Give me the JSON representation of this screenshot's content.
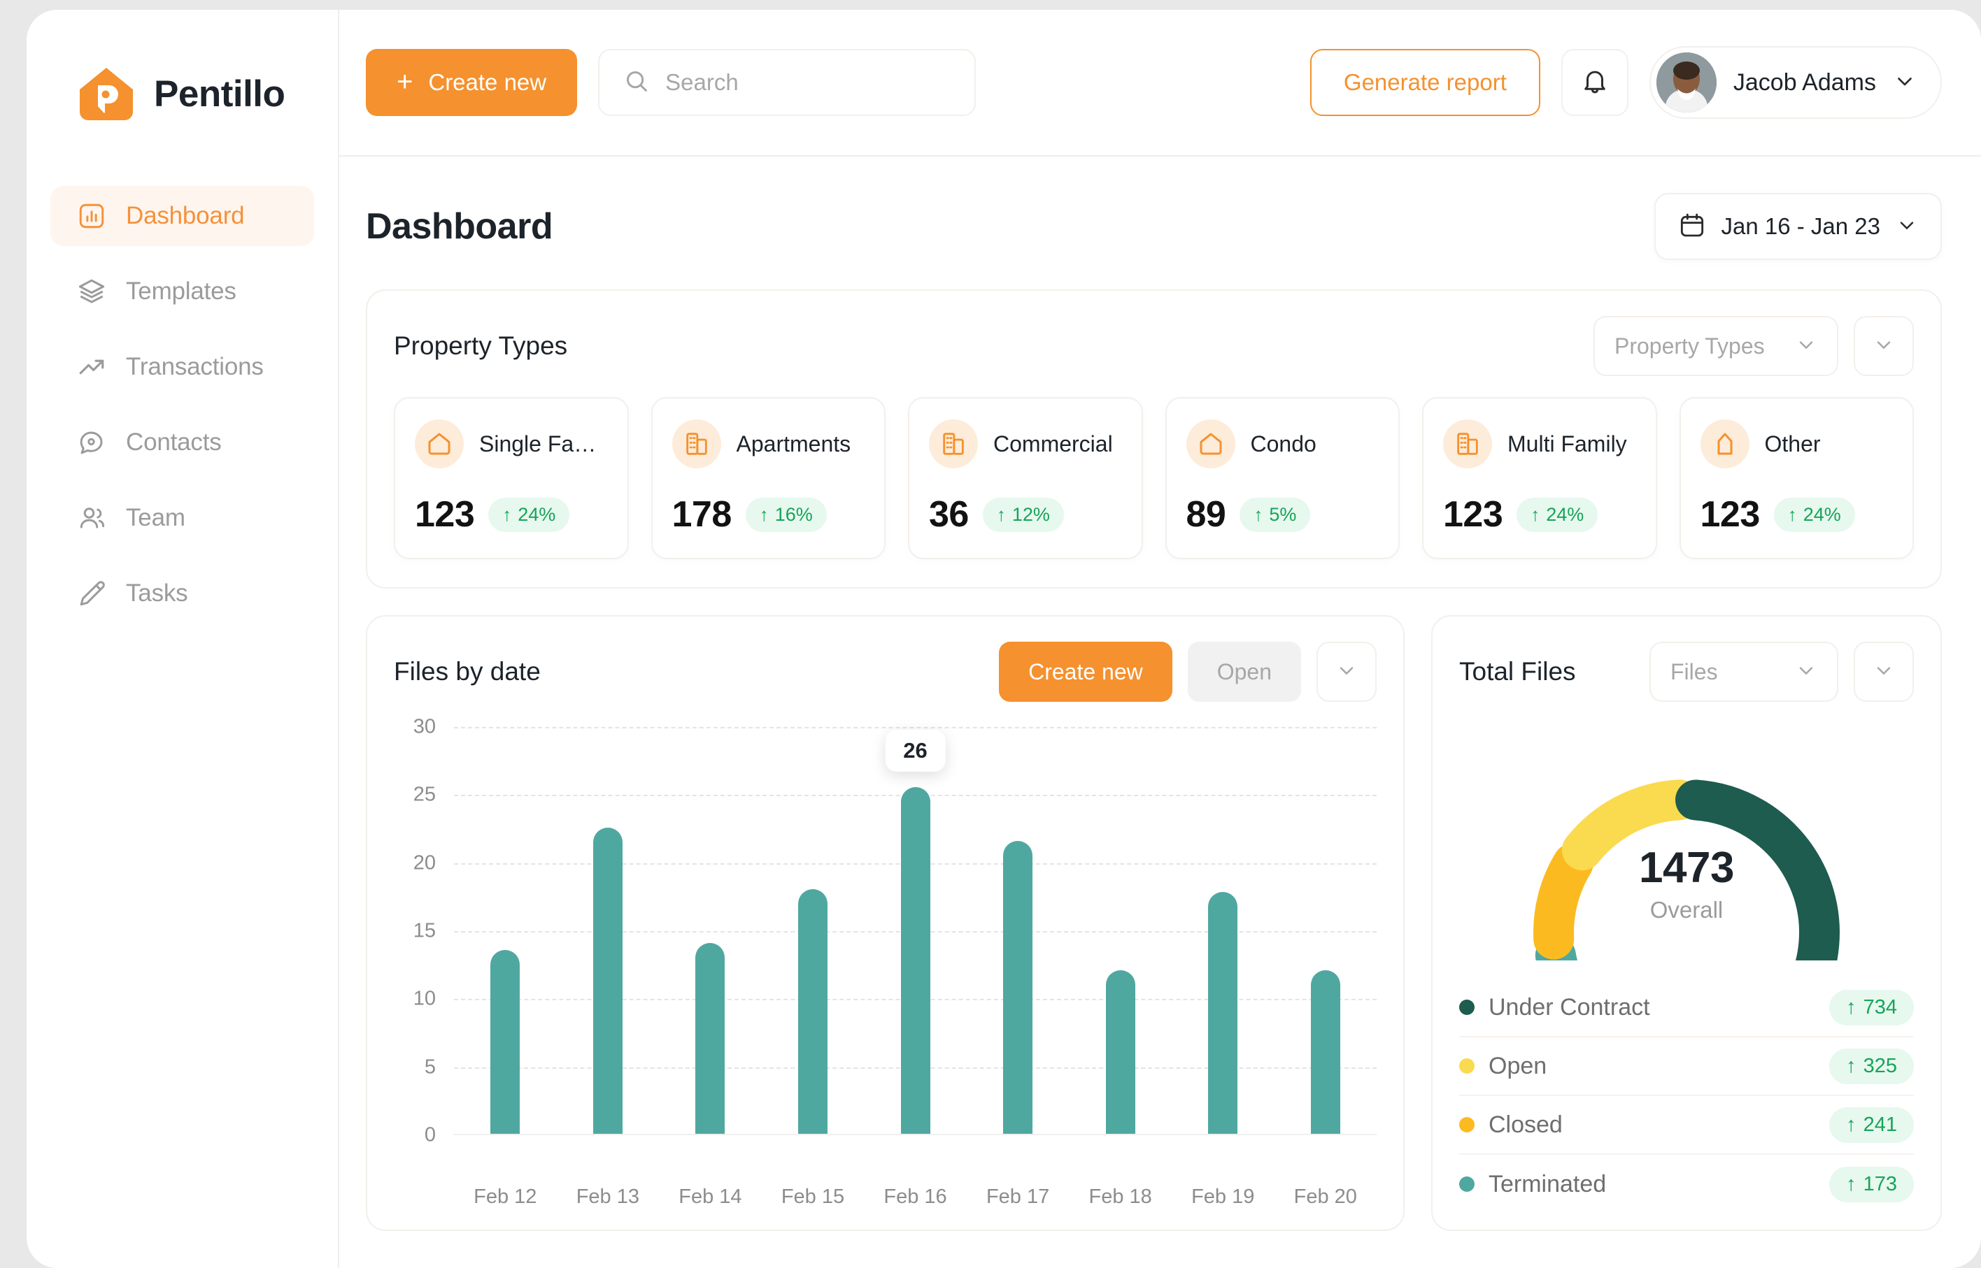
{
  "brand": {
    "name": "Pentillo",
    "logo_icon": "house-p-logo-icon",
    "accent": "#f5912e"
  },
  "sidebar": {
    "items": [
      {
        "label": "Dashboard",
        "icon": "chart-bar-square-icon",
        "active": true
      },
      {
        "label": "Templates",
        "icon": "layers-icon",
        "active": false
      },
      {
        "label": "Transactions",
        "icon": "trending-up-icon",
        "active": false
      },
      {
        "label": "Contacts",
        "icon": "chat-bubble-icon",
        "active": false
      },
      {
        "label": "Team",
        "icon": "users-icon",
        "active": false
      },
      {
        "label": "Tasks",
        "icon": "pencil-icon",
        "active": false
      }
    ]
  },
  "topbar": {
    "create_new_label": "Create new",
    "plus_icon": "plus-icon",
    "search": {
      "placeholder": "Search",
      "value": "",
      "icon": "search-icon"
    },
    "generate_report_label": "Generate report",
    "bell_icon": "bell-icon",
    "user": {
      "name": "Jacob Adams",
      "avatar_icon": "user-avatar",
      "chevron_icon": "chevron-down-icon"
    }
  },
  "page": {
    "title": "Dashboard",
    "date_range": {
      "label": "Jan 16 - Jan 23",
      "calendar_icon": "calendar-icon",
      "chevron_icon": "chevron-down-icon"
    }
  },
  "property_types": {
    "title": "Property Types",
    "filter": {
      "label": "Property Types",
      "chevron_icon": "chevron-down-icon"
    },
    "more_icon": "chevron-down-icon",
    "cards": [
      {
        "label": "Single Family",
        "value": "123",
        "change": "24%",
        "icon": "home-icon",
        "trend_icon": "arrow-up-icon"
      },
      {
        "label": "Apartments",
        "value": "178",
        "change": "16%",
        "icon": "buildings-icon",
        "trend_icon": "arrow-up-icon"
      },
      {
        "label": "Commercial",
        "value": "36",
        "change": "12%",
        "icon": "office-icon",
        "trend_icon": "arrow-up-icon"
      },
      {
        "label": "Condo",
        "value": "89",
        "change": "5%",
        "icon": "home-icon",
        "trend_icon": "arrow-up-icon"
      },
      {
        "label": "Multi Family",
        "value": "123",
        "change": "24%",
        "icon": "buildings-icon",
        "trend_icon": "arrow-up-icon"
      },
      {
        "label": "Other",
        "value": "123",
        "change": "24%",
        "icon": "shed-icon",
        "trend_icon": "arrow-up-icon"
      }
    ]
  },
  "files_by_date": {
    "title": "Files by date",
    "create_new_label": "Create new",
    "open_label": "Open",
    "more_icon": "chevron-down-icon"
  },
  "total_files": {
    "title": "Total Files",
    "filter": {
      "label": "Files",
      "chevron_icon": "chevron-down-icon"
    },
    "more_icon": "chevron-down-icon",
    "gauge_value": "1473",
    "gauge_sub": "Overall",
    "legend": [
      {
        "label": "Under Contract",
        "value": "734",
        "color": "#1d5c4e",
        "trend_icon": "arrow-up-icon"
      },
      {
        "label": "Open",
        "value": "325",
        "color": "#fada4e",
        "trend_icon": "arrow-up-icon"
      },
      {
        "label": "Closed",
        "value": "241",
        "color": "#fbbb20",
        "trend_icon": "arrow-up-icon"
      },
      {
        "label": "Terminated",
        "value": "173",
        "color": "#4fa8a0",
        "trend_icon": "arrow-up-icon"
      }
    ]
  },
  "chart_data": [
    {
      "type": "bar",
      "title": "Files by date",
      "xlabel": "",
      "ylabel": "",
      "categories": [
        "Feb 12",
        "Feb 13",
        "Feb 14",
        "Feb 15",
        "Feb 16",
        "Feb 17",
        "Feb 18",
        "Feb 19",
        "Feb 20"
      ],
      "values": [
        13.5,
        22.5,
        14,
        18,
        25.5,
        21.5,
        12,
        17.8,
        12
      ],
      "ylim": [
        0,
        30
      ],
      "yticks": [
        0,
        5,
        10,
        15,
        20,
        25,
        30
      ],
      "grid": true,
      "legend": "none",
      "bar_color": "#4fa8a0",
      "annotations": [
        {
          "category": "Feb 16",
          "label": "26"
        }
      ]
    },
    {
      "type": "pie",
      "title": "Total Files",
      "subtitle": "Overall",
      "center_value": 1473,
      "categories": [
        "Under Contract",
        "Open",
        "Closed",
        "Terminated"
      ],
      "values": [
        734,
        325,
        241,
        173
      ],
      "colors": [
        "#1d5c4e",
        "#fada4e",
        "#fbbb20",
        "#4fa8a0"
      ],
      "legend": "bottom"
    }
  ]
}
